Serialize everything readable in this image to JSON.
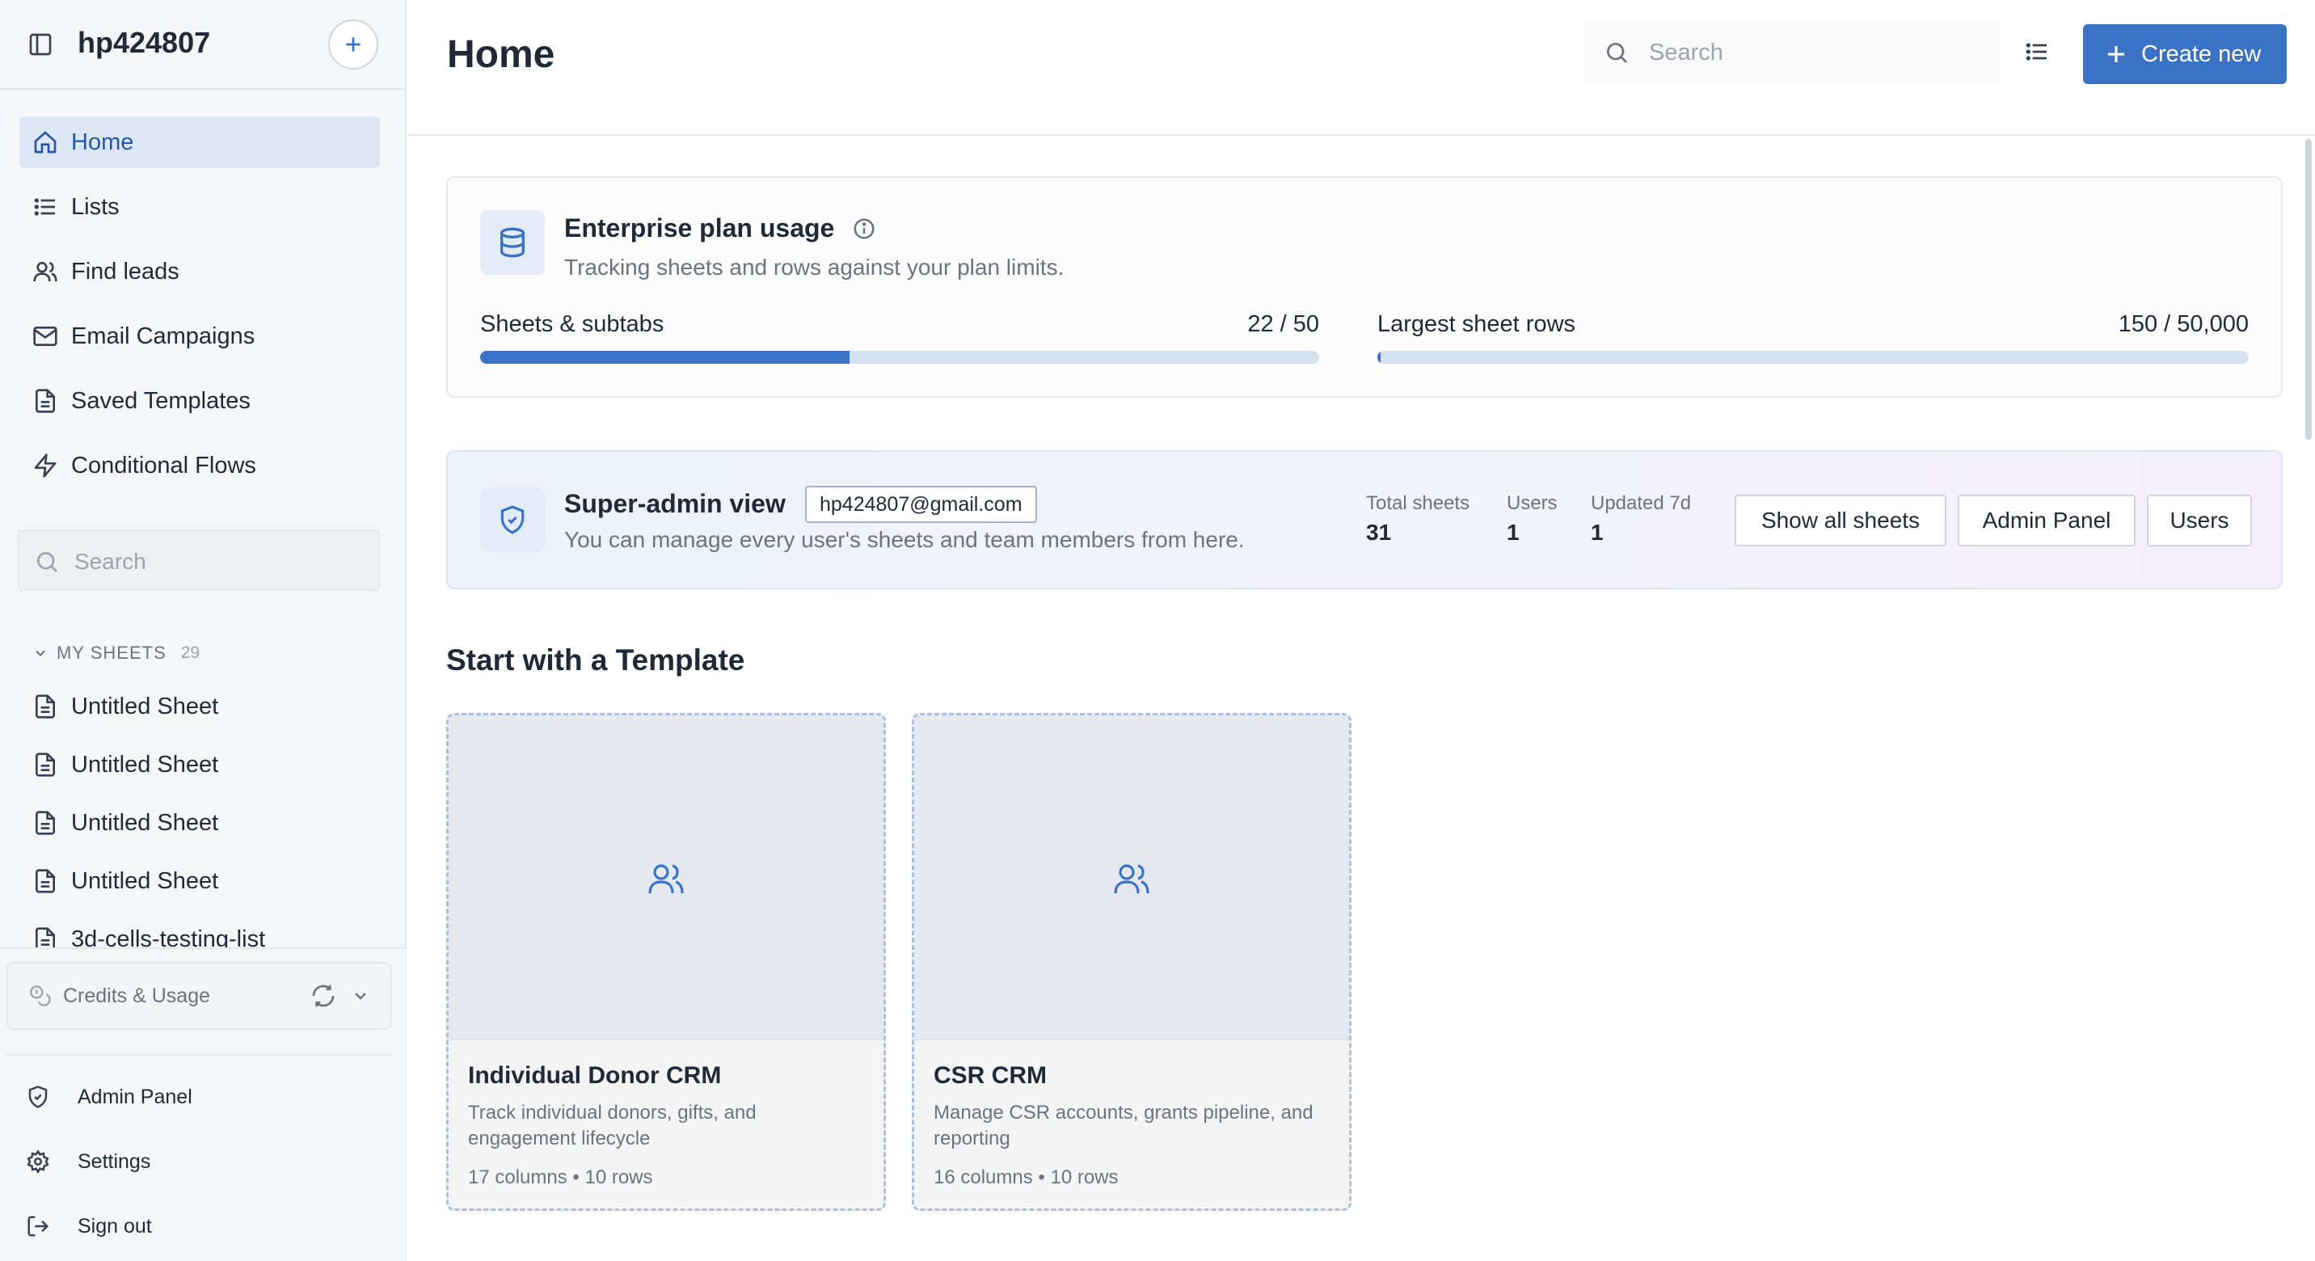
{
  "sidebar": {
    "workspace": "hp424807",
    "nav": [
      {
        "label": "Home",
        "icon": "home-icon",
        "active": true
      },
      {
        "label": "Lists",
        "icon": "list-icon"
      },
      {
        "label": "Find leads",
        "icon": "users-icon"
      },
      {
        "label": "Email Campaigns",
        "icon": "mail-icon"
      },
      {
        "label": "Saved Templates",
        "icon": "file-icon"
      },
      {
        "label": "Conditional Flows",
        "icon": "bolt-icon"
      }
    ],
    "search_placeholder": "Search",
    "sheets_section": {
      "label": "MY SHEETS",
      "count": "29"
    },
    "sheets": [
      "Untitled Sheet",
      "Untitled Sheet",
      "Untitled Sheet",
      "Untitled Sheet",
      "3d-cells-testing-list"
    ],
    "credits_label": "Credits & Usage",
    "footer": [
      {
        "label": "Admin Panel",
        "icon": "shield-icon"
      },
      {
        "label": "Settings",
        "icon": "gear-icon"
      },
      {
        "label": "Sign out",
        "icon": "sign-out-icon"
      }
    ]
  },
  "header": {
    "title": "Home",
    "search_placeholder": "Search",
    "create_label": "Create new"
  },
  "usage": {
    "title": "Enterprise plan usage",
    "subtitle": "Tracking sheets and rows against your plan limits.",
    "meters": [
      {
        "label": "Sheets & subtabs",
        "value": "22 / 50",
        "fraction": 0.44
      },
      {
        "label": "Largest sheet rows",
        "value": "150 / 50,000",
        "fraction": 0.003
      }
    ]
  },
  "admin": {
    "title": "Super-admin view",
    "email": "hp424807@gmail.com",
    "subtitle": "You can manage every user's sheets and team members from here.",
    "stats": [
      {
        "label": "Total sheets",
        "value": "31"
      },
      {
        "label": "Users",
        "value": "1"
      },
      {
        "label": "Updated 7d",
        "value": "1"
      }
    ],
    "buttons": [
      "Show all sheets",
      "Admin Panel",
      "Users"
    ]
  },
  "templates": {
    "title": "Start with a Template",
    "items": [
      {
        "name": "Individual Donor CRM",
        "description": "Track individual donors, gifts, and engagement lifecycle",
        "meta": "17 columns • 10 rows"
      },
      {
        "name": "CSR CRM",
        "description": "Manage CSR accounts, grants pipeline, and reporting",
        "meta": "16 columns • 10 rows"
      }
    ]
  },
  "colors": {
    "accent": "#3a72c5",
    "active_nav_bg": "#dde6f4",
    "progress_track": "#d6e1f0"
  }
}
